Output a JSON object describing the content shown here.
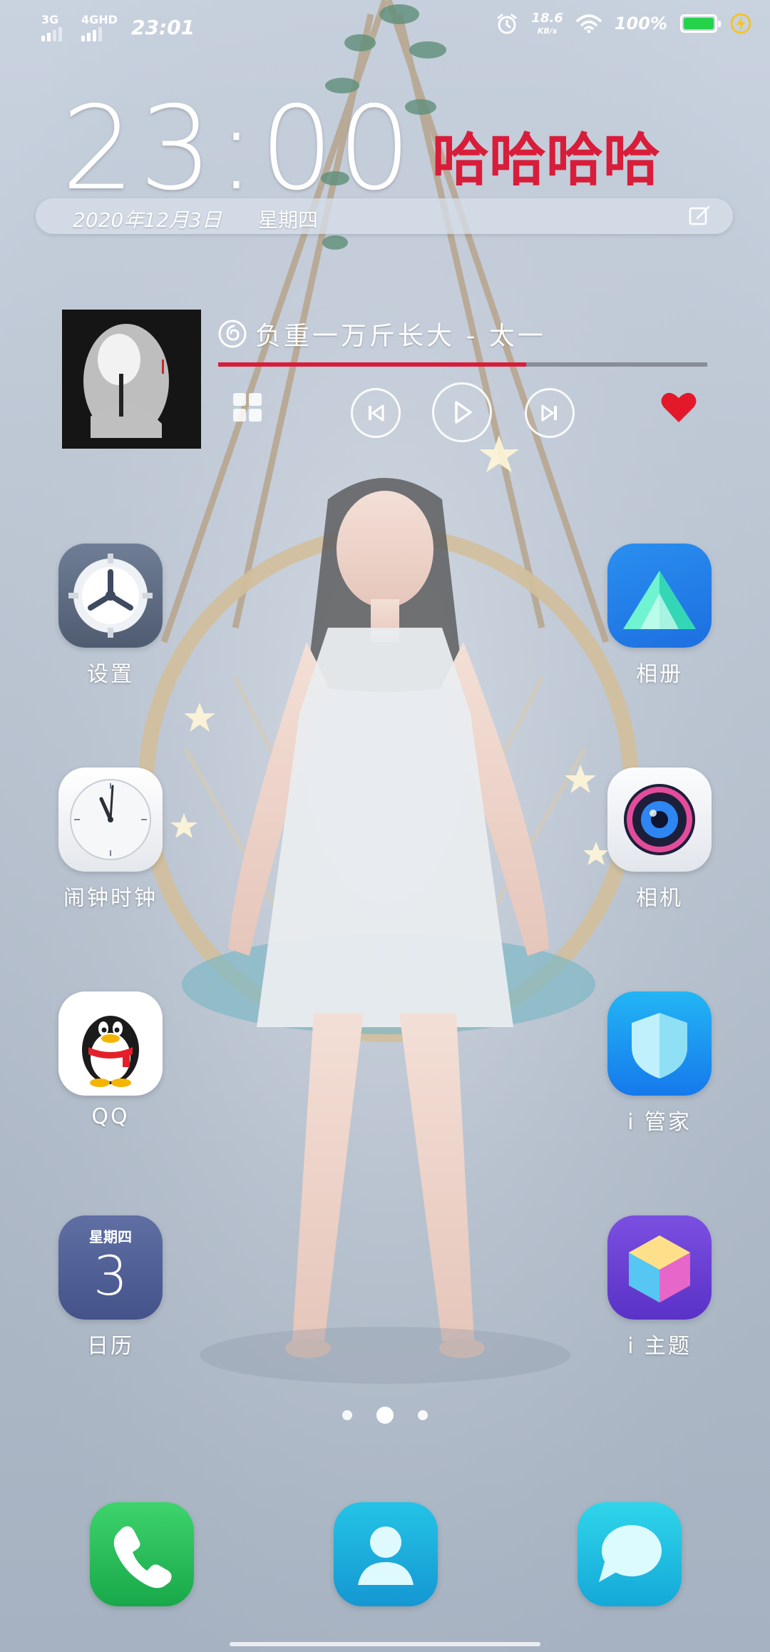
{
  "status_bar": {
    "network1_label": "3G",
    "network2_label": "4GHD",
    "time": "23:01",
    "speed_value": "18.6",
    "speed_unit": "KB/s",
    "battery_percent": "100%",
    "battery_level": 1.0,
    "battery_color": "#25d24a",
    "icons": [
      "signal-icon",
      "alarm-icon",
      "wifi-icon",
      "battery-icon",
      "charging-icon"
    ]
  },
  "clock_widget": {
    "time": "23:00",
    "custom_text": "哈哈哈哈",
    "custom_text_color": "#d81d3a",
    "date": "2020年12月3日",
    "weekday": "星期四",
    "edit_icon": "edit-icon"
  },
  "music_widget": {
    "song_title": "负重一万斤长大 - 太一",
    "progress": 0.63,
    "progress_color": "#d81d3a",
    "controls": [
      "playlist-icon",
      "previous-icon",
      "play-icon",
      "next-icon",
      "heart-icon"
    ],
    "heart_color": "#e3192b"
  },
  "apps": {
    "left": [
      {
        "label": "设置",
        "icon": "settings-icon"
      },
      {
        "label": "闹钟时钟",
        "icon": "clock-icon"
      },
      {
        "label": "QQ",
        "icon": "qq-icon"
      },
      {
        "label": "日历",
        "icon": "calendar-icon",
        "weekday": "星期四",
        "day": "3"
      }
    ],
    "right": [
      {
        "label": "相册",
        "icon": "gallery-icon"
      },
      {
        "label": "相机",
        "icon": "camera-icon"
      },
      {
        "label": "i 管家",
        "icon": "shield-icon"
      },
      {
        "label": "i 主题",
        "icon": "theme-icon"
      }
    ]
  },
  "page_indicator": {
    "count": 3,
    "active_index": 1
  },
  "dock": [
    {
      "icon": "phone-icon"
    },
    {
      "icon": "contacts-icon"
    },
    {
      "icon": "messages-icon"
    }
  ]
}
